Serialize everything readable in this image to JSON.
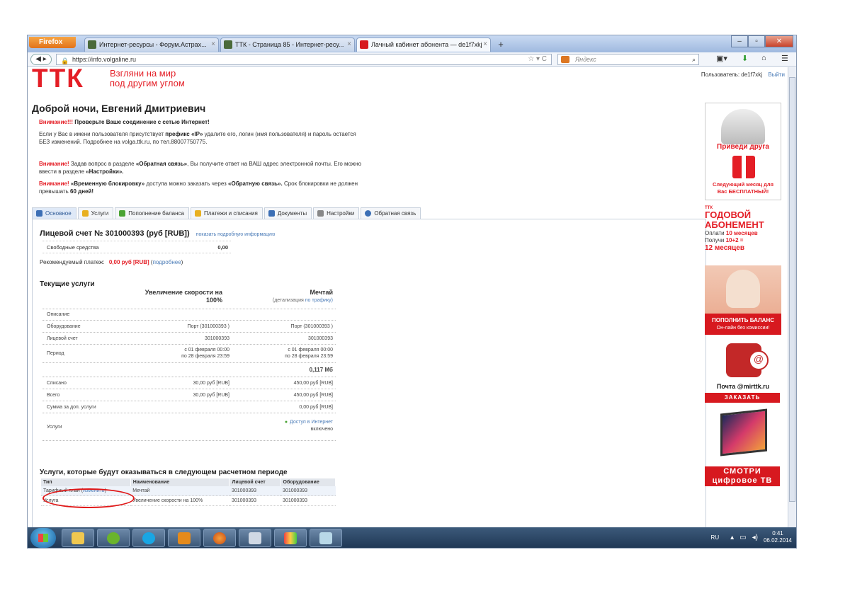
{
  "browser": {
    "firefox_label": "Firefox",
    "tabs": [
      {
        "title": "Интернет-ресурсы - Форум.Астрах..."
      },
      {
        "title": "ТТК - Страница 85 - Интернет-ресу..."
      },
      {
        "title": "Лачный кабинет абонента — de1f7xkj"
      }
    ],
    "new_tab": "+",
    "url": "https://info.volgaline.ru",
    "search_placeholder": "Яндекс"
  },
  "header": {
    "logo": "ТТК",
    "slogan_line1": "Взгляни на мир",
    "slogan_line2": "под другим углом",
    "user_label": "Пользователь: de1f7xkj",
    "logout": "Выйти"
  },
  "greeting": "Доброй ночи, Евгений Дмитриевич",
  "notices": {
    "n1_red": "Внимание!!!",
    "n1_bold": "Проверьте Ваше соединение с сетью Интернет!",
    "n2_a": "Если у Вас в имени пользователя присутствует",
    "n2_bold": "префикс «IP»",
    "n2_b": "удалите его, логин (имя пользователя) и пароль остается БЕЗ изменений. Подробнее на volga.ttk.ru, по тел.88007750775.",
    "n3_red": "Внимание!",
    "n3_a": "Задав вопрос в разделе",
    "n3_bold": "«Обратная связь»",
    "n3_b": ", Вы получите ответ на ВАШ адрес электронной почты. Его можно ввести в разделе",
    "n3_bold2": "«Настройки».",
    "n4_red": "Внимание!",
    "n4_bold": "«Временную блокировку»",
    "n4_a": "доступа можно заказать через",
    "n4_bold2": "«Обратную связь».",
    "n4_b": "Срок блокировки не должен превышать",
    "n4_bold3": "60 дней!"
  },
  "nav_tabs": [
    {
      "label": "Основное",
      "color": "#3c6fb5"
    },
    {
      "label": "Услуги",
      "color": "#e8b020"
    },
    {
      "label": "Пополнение баланса",
      "color": "#4aa334"
    },
    {
      "label": "Платежи и списания",
      "color": "#e8b020"
    },
    {
      "label": "Документы",
      "color": "#3c6fb5"
    },
    {
      "label": "Настройки",
      "color": "#888888"
    },
    {
      "label": "Обратная связь",
      "color": "#3c6fb5"
    }
  ],
  "account": {
    "title": "Лицевой счет № 301000393 (руб [RUB])",
    "more_link": "показать подробную информацию",
    "free_label": "Свободные средства",
    "free_value": "0,00",
    "recommend_label": "Рекомендуемый платеж:",
    "recommend_value": "0,00 руб [RUB]",
    "recommend_link": "подробнее"
  },
  "current_services": {
    "title": "Текущие услуги",
    "col1_title": "Увеличение скорости на 100%",
    "col2_title": "Мечтай",
    "col2_sub": "(детализация",
    "col2_sub_link": "по трафику)",
    "rows": [
      {
        "label": "Описание",
        "c1": "",
        "c2": ""
      },
      {
        "label": "Оборудование",
        "c1": "Порт (301000393 )",
        "c2": "Порт (301000393 )"
      },
      {
        "label": "Лицевой счет",
        "c1": "301000393",
        "c2": "301000393"
      },
      {
        "label": "Период",
        "c1a": "с 01 февраля 00:00",
        "c1b": "по 28 февраля 23:59",
        "c2a": "с 01 февраля 00:00",
        "c2b": "по 28 февраля 23:59"
      },
      {
        "label": "",
        "c1": "",
        "c2": "0,117 Мб"
      },
      {
        "label": "Списано",
        "c1": "30,00 руб [RUB]",
        "c2": "450,00 руб [RUB]"
      },
      {
        "label": "Всего",
        "c1": "30,00 руб [RUB]",
        "c2": "450,00 руб [RUB]"
      },
      {
        "label": "Сумма за доп. услуги",
        "c1": "",
        "c2": "0,00 руб [RUB]"
      },
      {
        "label": "Услуги",
        "c1": "",
        "c2a": "Доступ в Интернет",
        "c2b": "включено"
      }
    ]
  },
  "next_services": {
    "title": "Услуги, которые будут оказываться в следующем расчетном периоде",
    "headers": [
      "Тип",
      "Наименование",
      "Лицевой счет",
      "Оборудование"
    ],
    "rows": [
      {
        "type": "Тарифный план",
        "change": "изменить",
        "name": "Мечтай",
        "account": "301000393",
        "equipment": "301000393"
      },
      {
        "type": "Услуга",
        "change": "",
        "name": "Увеличение скорости на 100%",
        "account": "301000393",
        "equipment": "301000393"
      }
    ]
  },
  "ads": {
    "ad1_title": "Приведи друга",
    "ad1_line1": "Следующий месяц для",
    "ad1_line2": "Вас БЕСПЛАТНЫЙ!",
    "ad2_ttk": "ТТК",
    "ad2_l1": "ГОДОВОЙ",
    "ad2_l2": "АБОНЕМЕНТ",
    "ad2_l3a": "Оплати",
    "ad2_l3b": "10 месяцев",
    "ad2_l4a": "Получи",
    "ad2_l4b": "10+2 =",
    "ad2_l5": "12 месяцев",
    "ad3_title": "ПОПОЛНИТЬ БАЛАНС",
    "ad3_sub": "Он-лайн без комиссии!",
    "ad4_title": "Почта @mirttk.ru",
    "ad4_btn": "ЗАКАЗАТЬ",
    "ad5_l1": "СМОТРИ",
    "ad5_l2": "цифровое ТВ"
  },
  "taskbar": {
    "lang": "RU",
    "time": "0:41",
    "date": "06.02.2014"
  },
  "colors": {
    "brand_red": "#e41e26",
    "link_blue": "#4a7bb7",
    "highlight_circle": "#e01818"
  }
}
